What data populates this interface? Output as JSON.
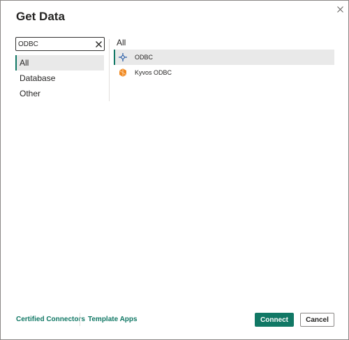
{
  "dialog": {
    "title": "Get Data"
  },
  "search": {
    "value": "ODBC",
    "placeholder": ""
  },
  "categories": [
    {
      "label": "All",
      "selected": true
    },
    {
      "label": "Database",
      "selected": false
    },
    {
      "label": "Other",
      "selected": false
    }
  ],
  "connectors": {
    "header": "All",
    "items": [
      {
        "label": "ODBC",
        "icon": "odbc-icon",
        "selected": true
      },
      {
        "label": "Kyvos ODBC",
        "icon": "kyvos-icon",
        "selected": false
      }
    ]
  },
  "footer": {
    "certified_connectors": "Certified Connectors",
    "template_apps": "Template Apps",
    "connect": "Connect",
    "cancel": "Cancel"
  },
  "colors": {
    "accent": "#117865",
    "selected_bg": "#e9e9e9",
    "odbc_icon": "#2b5fa8",
    "kyvos_icon": "#f08a24"
  }
}
